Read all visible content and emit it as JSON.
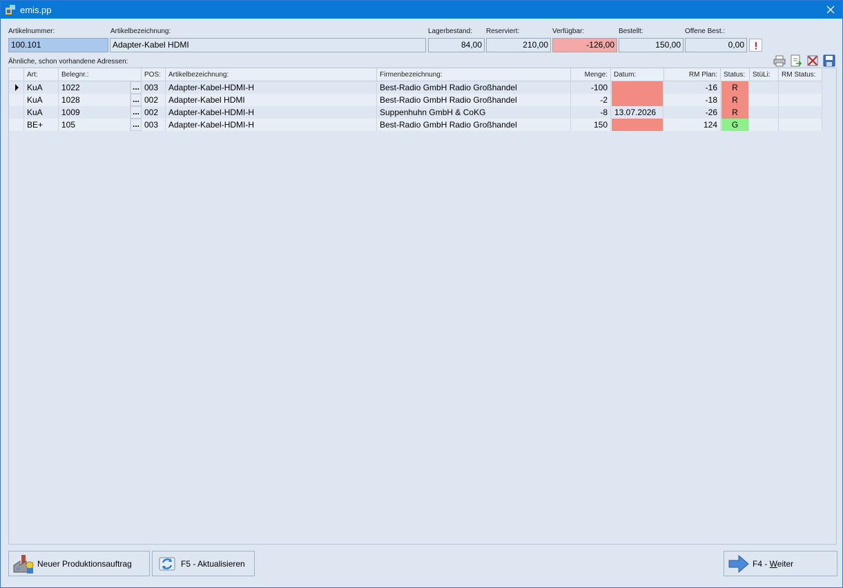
{
  "window": {
    "title": "emis.pp"
  },
  "header": {
    "artikelnummer": {
      "label": "Artikelnummer:",
      "value": "100.101"
    },
    "artikelbezeichnung": {
      "label": "Artikelbezeichnung:",
      "value": "Adapter-Kabel HDMI"
    },
    "lagerbestand": {
      "label": "Lagerbestand:",
      "value": "84,00"
    },
    "reserviert": {
      "label": "Reserviert:",
      "value": "210,00"
    },
    "verfuegbar": {
      "label": "Verfügbar:",
      "value": "-126,00"
    },
    "bestellt": {
      "label": "Bestellt:",
      "value": "150,00"
    },
    "offene_best": {
      "label": "Offene Best.:",
      "value": "0,00"
    }
  },
  "section_label": "Ähnliche, schon vorhandene Adressen:",
  "toolbar": {
    "icons": [
      "print-icon",
      "export-icon",
      "delete-icon",
      "save-icon"
    ]
  },
  "grid": {
    "columns": [
      "Art:",
      "Belegnr.:",
      "POS:",
      "Artikelbezeichnung:",
      "Firmenbezeichnung:",
      "Menge:",
      "Datum:",
      "RM Plan:",
      "Status:",
      "StüLi:",
      "RM Status:"
    ],
    "rows": [
      {
        "art": "KuA",
        "belegnr": "1022",
        "dots": "...",
        "pos": "003",
        "artikel": "Adapter-Kabel-HDMI-H",
        "firma": "Best-Radio GmbH Radio Großhandel",
        "menge": "-100",
        "datum": "",
        "rm_plan": "-16",
        "status": "R",
        "stueli": "",
        "rm_status": ""
      },
      {
        "art": "KuA",
        "belegnr": "1028",
        "dots": "...",
        "pos": "002",
        "artikel": "Adapter-Kabel HDMI",
        "firma": "Best-Radio GmbH Radio Großhandel",
        "menge": "-2",
        "datum": "",
        "rm_plan": "-18",
        "status": "R",
        "stueli": "",
        "rm_status": ""
      },
      {
        "art": "KuA",
        "belegnr": "1009",
        "dots": "...",
        "pos": "002",
        "artikel": "Adapter-Kabel-HDMI-H",
        "firma": "Suppenhuhn GmbH & CoKG",
        "menge": "-8",
        "datum": "13.07.2026",
        "rm_plan": "-26",
        "status": "R",
        "stueli": "",
        "rm_status": ""
      },
      {
        "art": "BE+",
        "belegnr": "105",
        "dots": "...",
        "pos": "003",
        "artikel": "Adapter-Kabel-HDMI-H",
        "firma": "Best-Radio GmbH Radio Großhandel",
        "menge": "150",
        "datum": "",
        "rm_plan": "124",
        "status": "G",
        "stueli": "",
        "rm_status": ""
      }
    ]
  },
  "buttons": {
    "neuer_produktionsauftrag": "Neuer Produktionsauftrag",
    "aktualisieren": "F5 - Aktualisieren",
    "weiter_prefix": "F4 - ",
    "weiter_key": "W",
    "weiter_rest": "eiter"
  },
  "colors": {
    "titlebar": "#0a78d7",
    "negative": "#f4a8a8",
    "status_red": "#f28b82",
    "status_green": "#8ef08a"
  }
}
